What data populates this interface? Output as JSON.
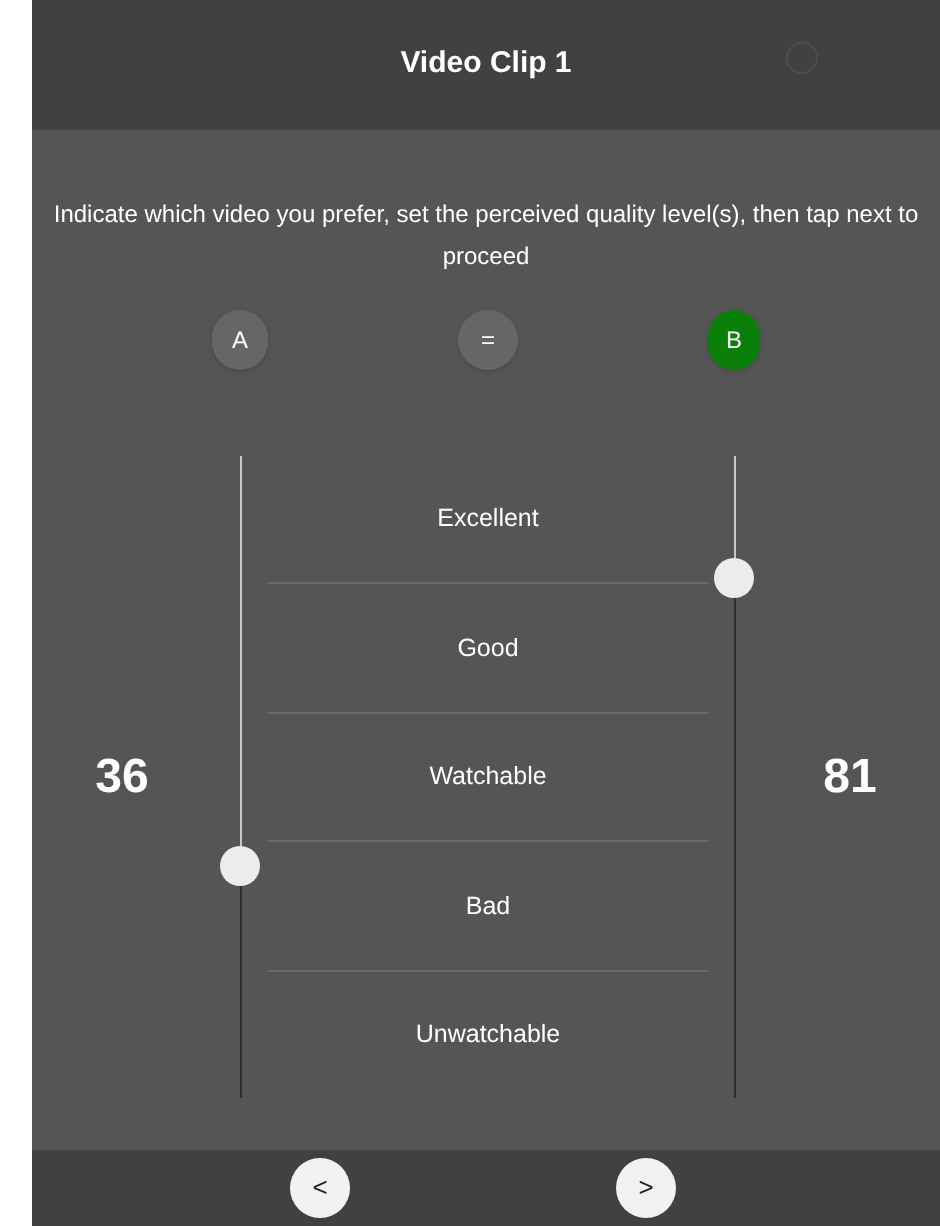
{
  "header": {
    "title": "Video Clip 1"
  },
  "instruction": "Indicate which video you prefer, set the perceived quality level(s), then tap next to proceed",
  "choices": [
    {
      "label": "A",
      "selected": false
    },
    {
      "label": "=",
      "selected": false
    },
    {
      "label": "B",
      "selected": true
    }
  ],
  "sliders": [
    {
      "reading": "36",
      "level": 0.36
    },
    {
      "reading": "81",
      "level": 0.81
    }
  ],
  "quality_levels": [
    "Excellent",
    "Good",
    "Watchable",
    "Bad",
    "Unwatchable"
  ],
  "footer": {
    "buttons": [
      "<",
      ">"
    ]
  }
}
